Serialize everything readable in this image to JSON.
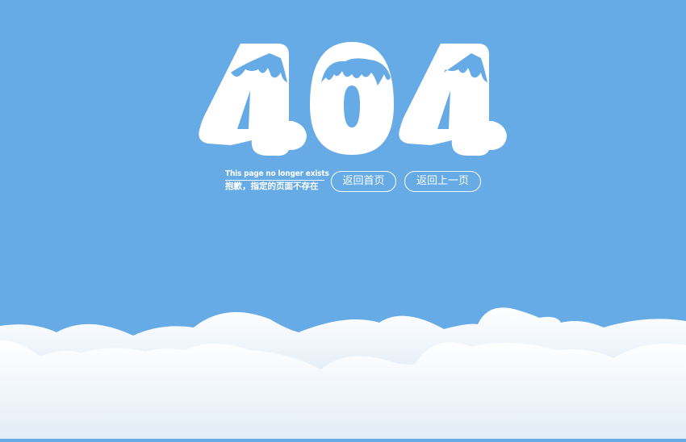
{
  "error": {
    "code_digits": [
      "4",
      "0",
      "4"
    ],
    "message_en": "This page no longer exists",
    "message_cn": "抱歉，指定的页面不存在"
  },
  "actions": {
    "home_label": "返回首页",
    "back_label": "返回上一页"
  },
  "colors": {
    "sky": "#66abe6",
    "snow": "#ffffff",
    "cloud_shadow": "#c3dcf0"
  }
}
